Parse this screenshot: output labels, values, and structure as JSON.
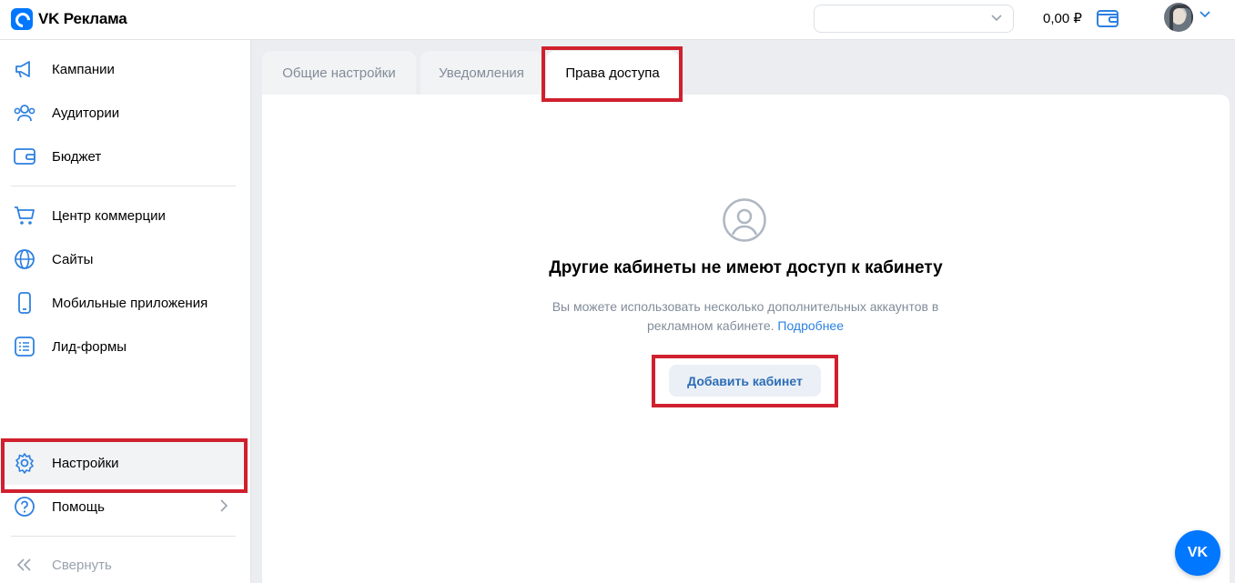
{
  "header": {
    "logo_text": "VK Реклама",
    "balance": "0,00 ₽",
    "account_select_value": ""
  },
  "sidebar": {
    "items": [
      {
        "label": "Кампании",
        "icon": "megaphone-icon"
      },
      {
        "label": "Аудитории",
        "icon": "users-icon"
      },
      {
        "label": "Бюджет",
        "icon": "wallet-icon"
      },
      {
        "label": "Центр коммерции",
        "icon": "cart-icon"
      },
      {
        "label": "Сайты",
        "icon": "globe-icon"
      },
      {
        "label": "Мобильные приложения",
        "icon": "phone-icon"
      },
      {
        "label": "Лид-формы",
        "icon": "list-icon"
      },
      {
        "label": "Настройки",
        "icon": "gear-icon"
      },
      {
        "label": "Помощь",
        "icon": "help-icon"
      }
    ],
    "collapse_label": "Свернуть"
  },
  "tabs": [
    {
      "label": "Общие настройки"
    },
    {
      "label": "Уведомления"
    },
    {
      "label": "Права доступа"
    }
  ],
  "main": {
    "empty_title": "Другие кабинеты не имеют доступ к кабинету",
    "empty_desc": "Вы можете использовать несколько дополнительных аккаунтов в рекламном кабинете.",
    "more_link": "Подробнее",
    "add_button": "Добавить кабинет"
  },
  "fab": {
    "label": "VK"
  },
  "colors": {
    "accent": "#0077ff",
    "highlight": "#d0202e"
  }
}
